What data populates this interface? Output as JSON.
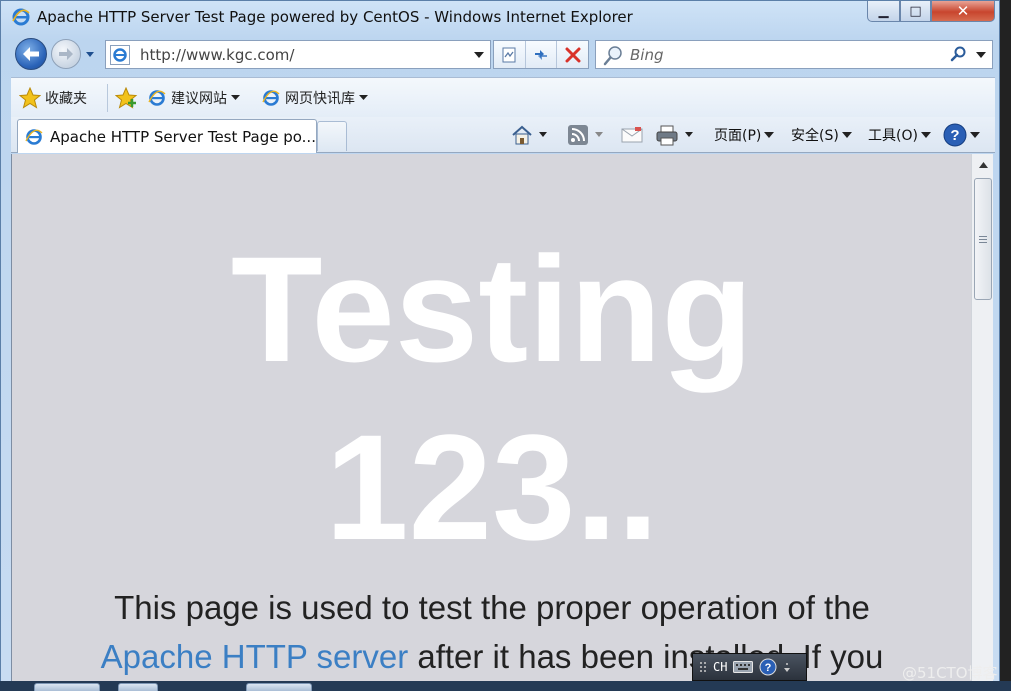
{
  "window": {
    "title": "Apache HTTP Server Test Page powered by CentOS - Windows Internet Explorer",
    "controls": {
      "minimize": "▁",
      "maximize": "□",
      "close": "✕"
    }
  },
  "address": {
    "url": "http://www.kgc.com/",
    "search_placeholder": "Bing"
  },
  "favorites": {
    "favorites_label": "收藏夹",
    "suggested_sites": "建议网站",
    "web_slice_gallery": "网页快讯库"
  },
  "tabs": [
    {
      "label": "Apache HTTP Server Test Page po..."
    }
  ],
  "commandbar": {
    "page": "页面(P)",
    "safety": "安全(S)",
    "tools": "工具(O)"
  },
  "content": {
    "hero_line1": "Testing",
    "hero_line2": "123..",
    "para_line1": "This page is used to test the proper operation of the",
    "para_link": "Apache HTTP server",
    "para_line2_rest": " after it has been installed. If you"
  },
  "langbar": {
    "lang": "CH"
  },
  "watermark": "@51CTO博客",
  "colors": {
    "content_bg": "#d6d6dc",
    "hero_text": "#ffffff",
    "link": "#3b7fc4",
    "chrome": "#c8dcf2"
  }
}
